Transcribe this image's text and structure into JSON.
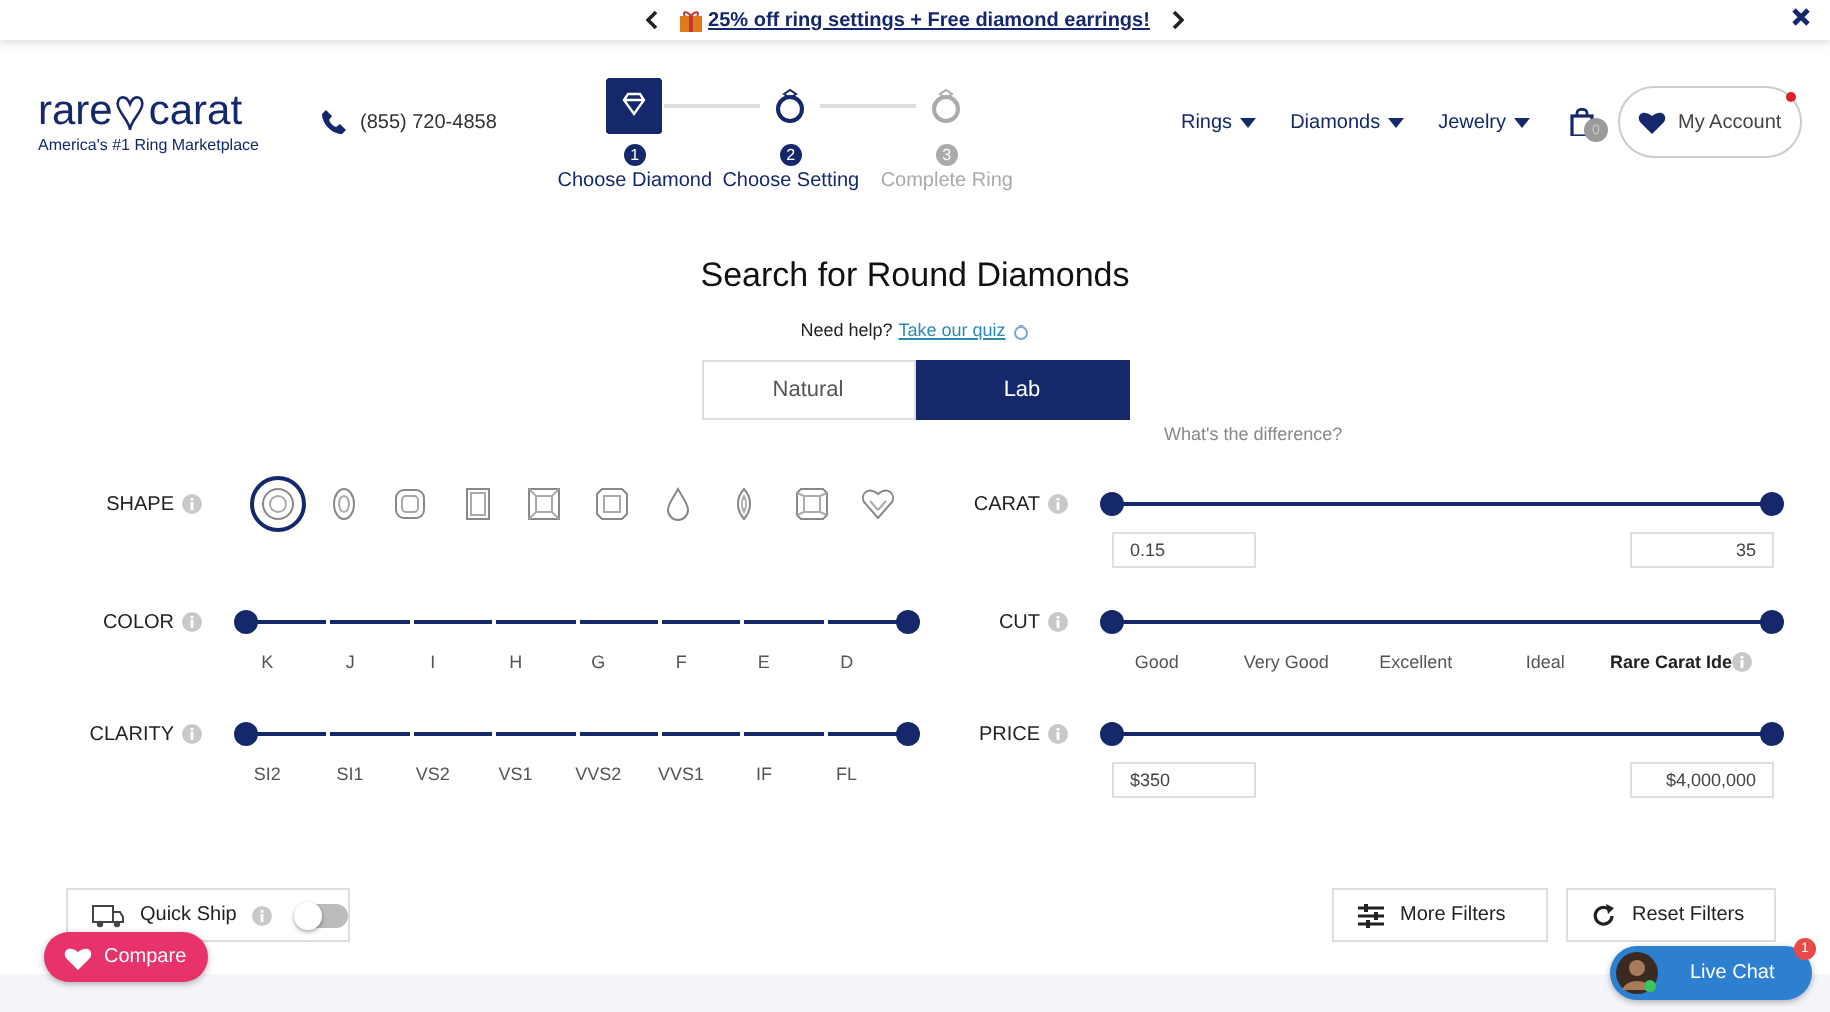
{
  "promo_bar": {
    "text": "25% off ring settings + Free diamond earrings!"
  },
  "header": {
    "logo": {
      "left": "rare",
      "right": "carat",
      "tagline": "America's #1 Ring Marketplace"
    },
    "phone": "(855) 720-4858",
    "steps": [
      {
        "number": "1",
        "label": "Choose Diamond",
        "selected": true,
        "disabled": false
      },
      {
        "number": "2",
        "label": "Choose Setting",
        "selected": false,
        "disabled": false
      },
      {
        "number": "3",
        "label": "Complete Ring",
        "selected": false,
        "disabled": true
      }
    ],
    "nav": [
      {
        "label": "Rings"
      },
      {
        "label": "Diamonds"
      },
      {
        "label": "Jewelry"
      }
    ],
    "cart_count": "0",
    "account": {
      "label": "My Account",
      "notification": true
    }
  },
  "search": {
    "title": "Search for Round Diamonds",
    "help": "Need help?",
    "quiz_link": "Take our quiz",
    "origin_tabs": [
      {
        "label": "Natural",
        "selected": false
      },
      {
        "label": "Lab",
        "selected": true
      }
    ],
    "difference_link": "What's the difference?"
  },
  "filters_left": [
    {
      "kind": "shapes",
      "label": "SHAPE",
      "shapes": [
        {
          "kind": "round",
          "selected": true
        },
        {
          "kind": "oval",
          "selected": false
        },
        {
          "kind": "cushion",
          "selected": false
        },
        {
          "kind": "emerald",
          "selected": false
        },
        {
          "kind": "princess",
          "selected": false
        },
        {
          "kind": "asscher",
          "selected": false
        },
        {
          "kind": "pear",
          "selected": false
        },
        {
          "kind": "marquise",
          "selected": false
        },
        {
          "kind": "radiant",
          "selected": false
        },
        {
          "kind": "heart",
          "selected": false
        }
      ]
    },
    {
      "kind": "grades",
      "label": "COLOR",
      "thumbs": [
        {
          "level": 0
        },
        {
          "level": 1
        }
      ],
      "ticks": [
        "K",
        "J",
        "I",
        "H",
        "G",
        "F",
        "E",
        "D"
      ]
    },
    {
      "kind": "grades",
      "label": "CLARITY",
      "thumbs": [
        {
          "level": 0
        },
        {
          "level": 1
        }
      ],
      "ticks": [
        "SI2",
        "SI1",
        "VS2",
        "VS1",
        "VVS2",
        "VVS1",
        "IF",
        "FL"
      ]
    }
  ],
  "filters_right": [
    {
      "kind": "range",
      "label": "CARAT",
      "thumbs": [
        {
          "level": 0
        },
        {
          "level": 1
        }
      ],
      "min": "0.15",
      "max": "35"
    },
    {
      "kind": "cut",
      "label": "CUT",
      "thumbs": [
        {
          "level": 0
        },
        {
          "level": 1
        }
      ],
      "ticks": [
        "Good",
        "Very Good",
        "Excellent",
        "Ideal",
        "Rare Carat Ide"
      ]
    },
    {
      "kind": "range",
      "label": "PRICE",
      "thumbs": [
        {
          "level": 0
        },
        {
          "level": 1
        }
      ],
      "min": "$350",
      "max": "$4,000,000"
    }
  ],
  "bottom_bar": {
    "quick_ship": {
      "label": "Quick Ship",
      "on": false
    },
    "more_filters": "More Filters",
    "reset_filters": "Reset Filters",
    "compare": "Compare",
    "live_chat": {
      "label": "Live Chat",
      "badge": "1"
    }
  }
}
